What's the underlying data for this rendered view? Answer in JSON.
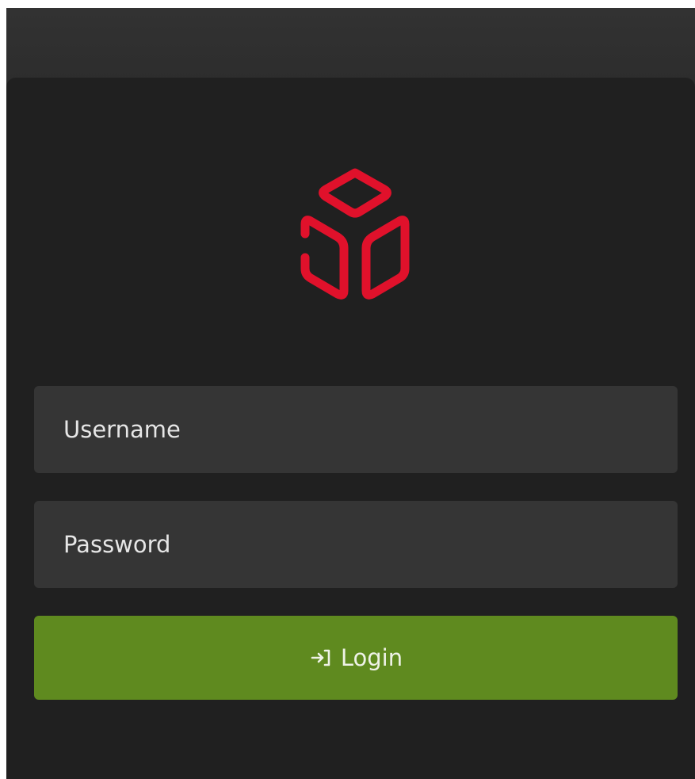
{
  "colors": {
    "accent_logo": "#e0112b",
    "login_button": "#5f8a1f",
    "panel_background": "#202020",
    "field_background": "#353535"
  },
  "logo": {
    "icon": "cube-logo-icon"
  },
  "form": {
    "username_placeholder": "Username",
    "password_placeholder": "Password",
    "login_label": "Login",
    "login_icon": "login-arrow-icon"
  }
}
